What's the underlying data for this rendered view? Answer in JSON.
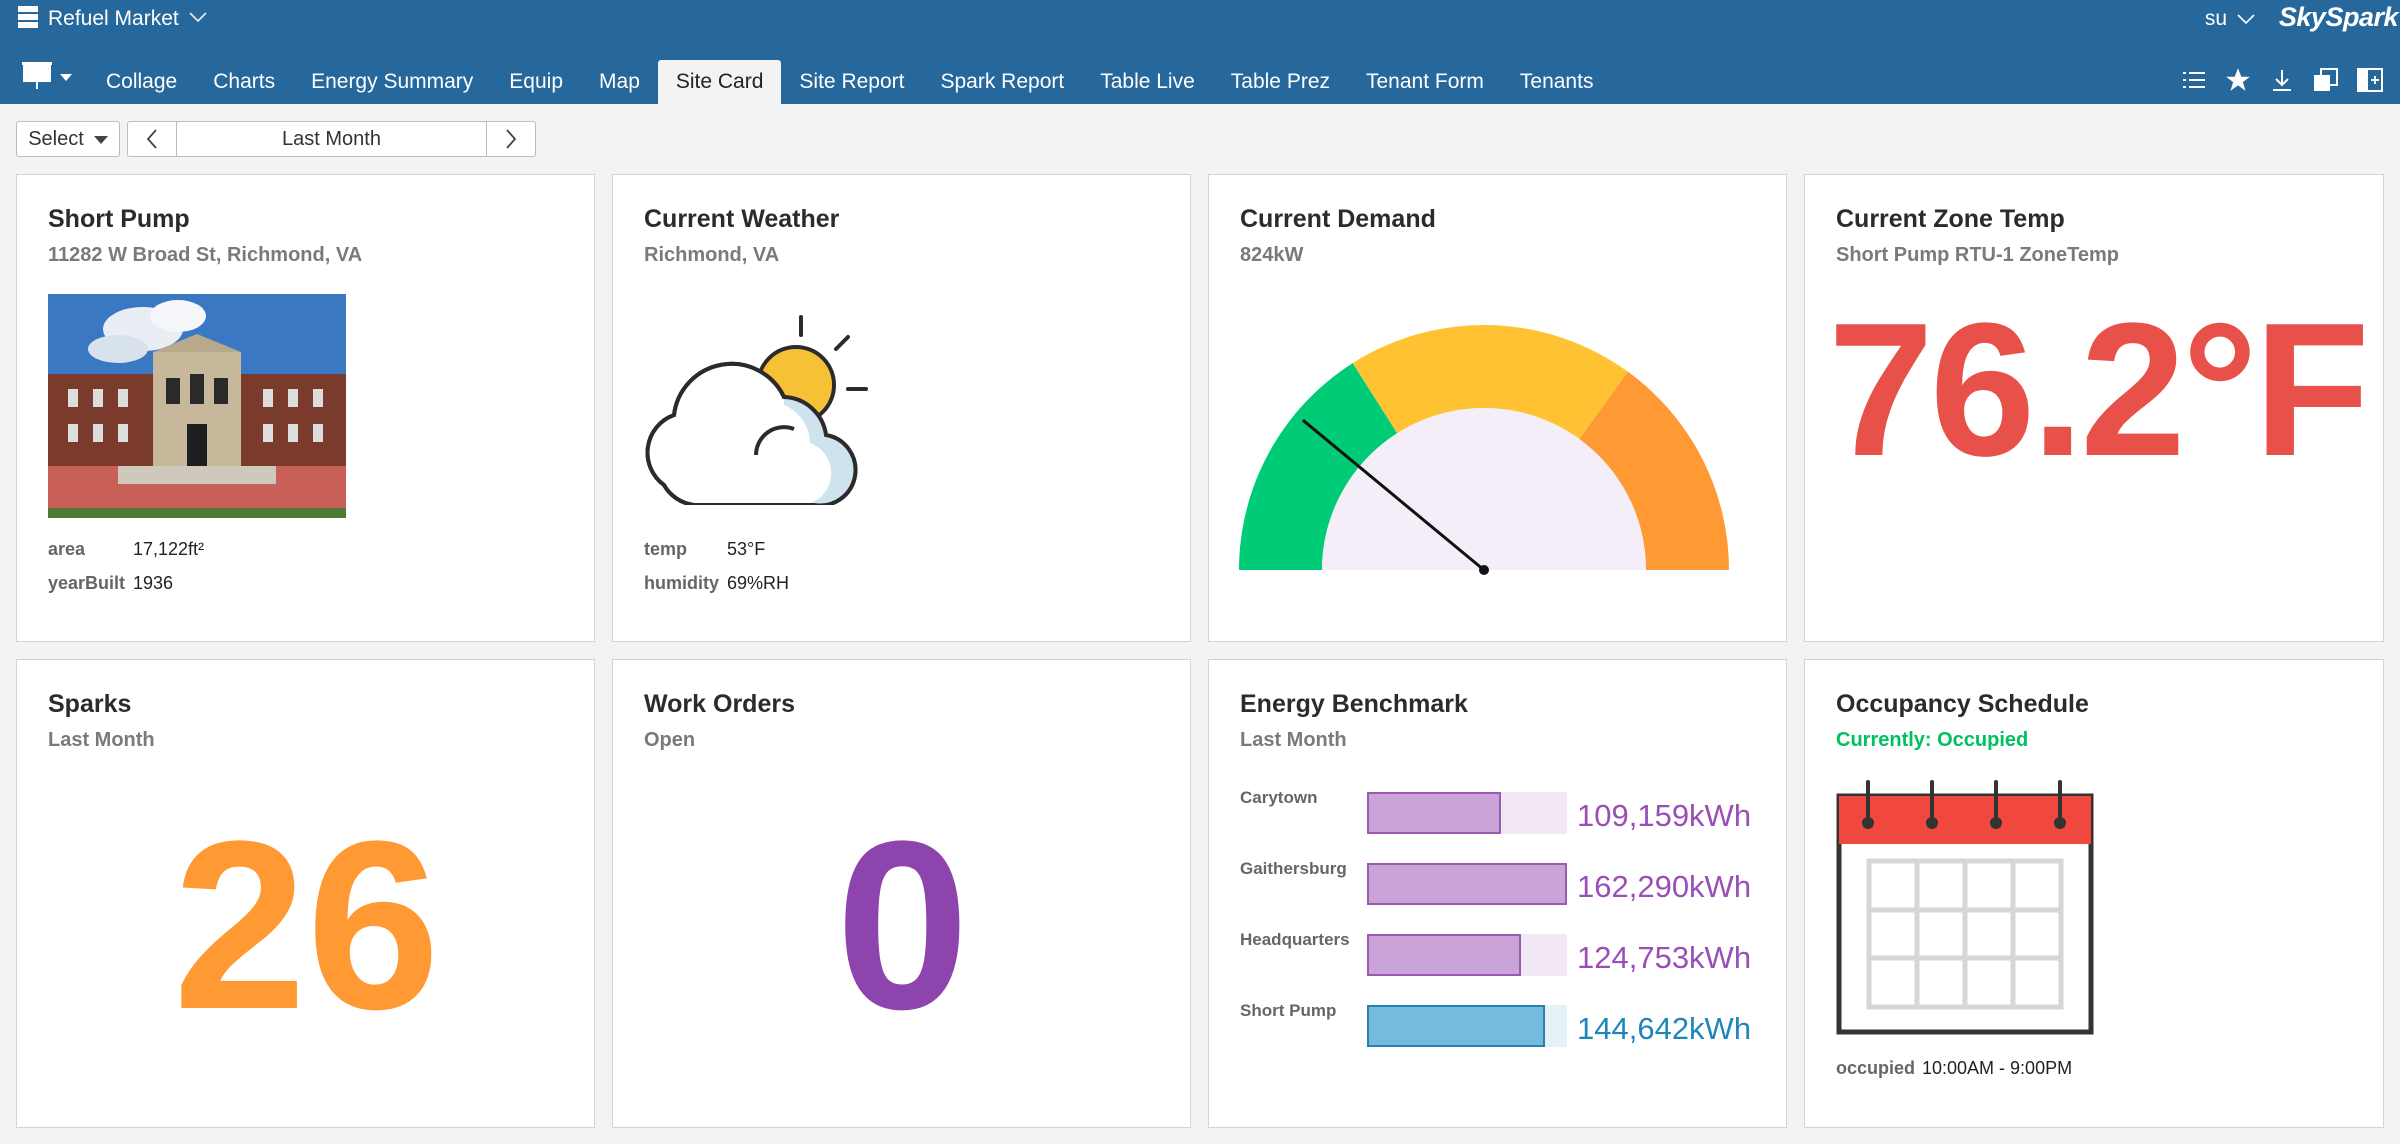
{
  "app": {
    "name": "Refuel Market",
    "user": "su",
    "brand": "SkySpark"
  },
  "tabs": [
    "Collage",
    "Charts",
    "Energy Summary",
    "Equip",
    "Map",
    "Site Card",
    "Site Report",
    "Spark Report",
    "Table Live",
    "Table Prez",
    "Tenant Form",
    "Tenants"
  ],
  "active_tab": "Site Card",
  "toolbar": {
    "select_label": "Select",
    "date_range": "Last Month"
  },
  "cards": {
    "site": {
      "title": "Short Pump",
      "address": "11282 W Broad St, Richmond, VA",
      "area_label": "area",
      "area_value": "17,122ft²",
      "year_label": "yearBuilt",
      "year_value": "1936"
    },
    "weather": {
      "title": "Current Weather",
      "location": "Richmond, VA",
      "icon": "partly-cloudy-icon",
      "temp_label": "temp",
      "temp_value": "53°F",
      "humidity_label": "humidity",
      "humidity_value": "69%RH"
    },
    "demand": {
      "title": "Current Demand",
      "value": "824kW",
      "gauge_fraction": 0.22,
      "colors": [
        "#00cc77",
        "#ffc233",
        "#ff9933"
      ]
    },
    "zone_temp": {
      "title": "Current Zone Temp",
      "point": "Short Pump RTU-1 ZoneTemp",
      "value": "76.2°F",
      "color": "#e8504a"
    },
    "sparks": {
      "title": "Sparks",
      "sub": "Last Month",
      "value": "26",
      "color": "#ff9933"
    },
    "work_orders": {
      "title": "Work Orders",
      "sub": "Open",
      "value": "0",
      "color": "#8e44ad"
    },
    "benchmark": {
      "title": "Energy Benchmark",
      "sub": "Last Month",
      "rows": [
        {
          "name": "Carytown",
          "value": "109,159kWh",
          "fraction": 0.67,
          "highlight": false
        },
        {
          "name": "Gaithersburg",
          "value": "162,290kWh",
          "fraction": 1.0,
          "highlight": false
        },
        {
          "name": "Headquarters",
          "value": "124,753kWh",
          "fraction": 0.77,
          "highlight": false
        },
        {
          "name": "Short Pump",
          "value": "144,642kWh",
          "fraction": 0.89,
          "highlight": true
        }
      ]
    },
    "occupancy": {
      "title": "Occupancy Schedule",
      "status": "Currently: Occupied",
      "status_color": "#00c060",
      "occ_label": "occupied",
      "occ_value": "10:00AM - 9:00PM"
    }
  }
}
